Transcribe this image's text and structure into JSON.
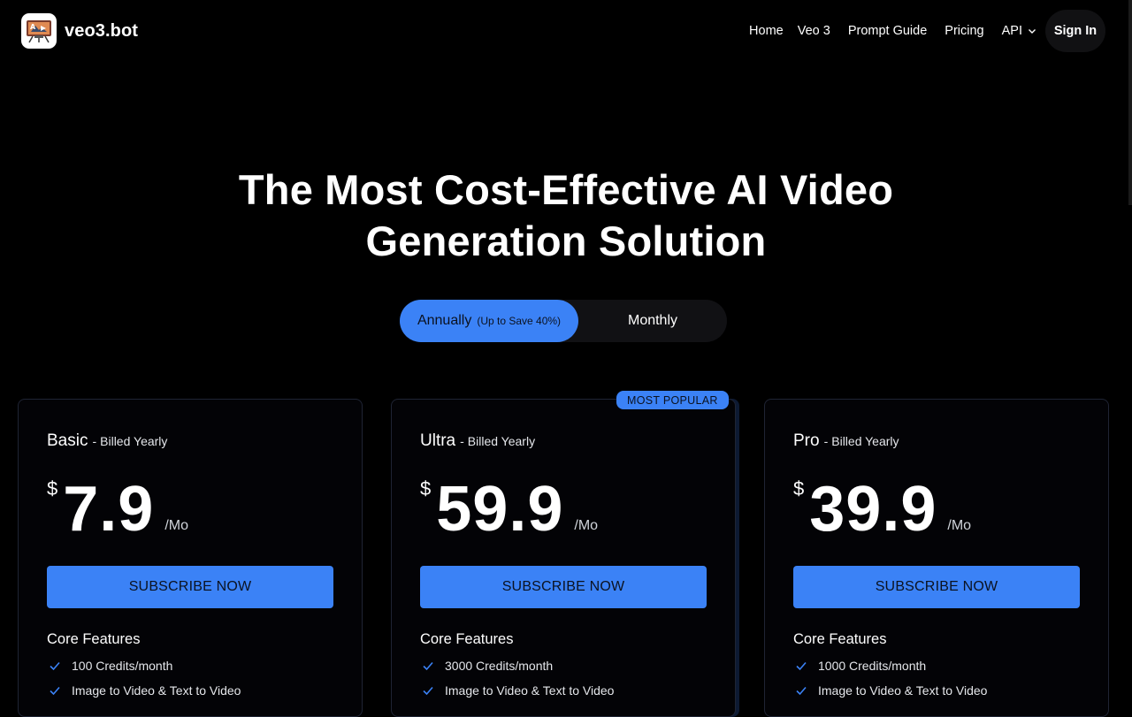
{
  "header": {
    "brand_name": "veo3.bot",
    "logo_icon": "video-projector-logo-icon",
    "nav": {
      "home": "Home",
      "veo3": "Veo 3",
      "prompt_guide": "Prompt Guide",
      "pricing": "Pricing",
      "api": "API"
    },
    "sign_in": "Sign In"
  },
  "hero": {
    "title_line1": "The Most Cost-Effective AI Video",
    "title_line2": "Generation Solution"
  },
  "billing_toggle": {
    "annual_label": "Annually",
    "annual_note": "(Up to Save 40%)",
    "monthly_label": "Monthly",
    "selected": "Annually"
  },
  "most_popular_badge": "MOST POPULAR",
  "plans": [
    {
      "name": "Basic",
      "separator": "-",
      "billing": "Billed Yearly",
      "currency": "$",
      "price": "7.9",
      "period": "/Mo",
      "cta": "SUBSCRIBE NOW",
      "features_title": "Core Features",
      "features": [
        "100 Credits/month",
        "Image to Video & Text to Video"
      ]
    },
    {
      "name": "Ultra",
      "separator": "-",
      "billing": "Billed Yearly",
      "currency": "$",
      "price": "59.9",
      "period": "/Mo",
      "cta": "SUBSCRIBE NOW",
      "features_title": "Core Features",
      "features": [
        "3000 Credits/month",
        "Image to Video & Text to Video"
      ]
    },
    {
      "name": "Pro",
      "separator": "-",
      "billing": "Billed Yearly",
      "currency": "$",
      "price": "39.9",
      "period": "/Mo",
      "cta": "SUBSCRIBE NOW",
      "features_title": "Core Features",
      "features": [
        "1000 Credits/month",
        "Image to Video & Text to Video"
      ]
    }
  ],
  "colors": {
    "background": "#000000",
    "accent": "#3b82f6",
    "card_border": "#1f2434"
  }
}
